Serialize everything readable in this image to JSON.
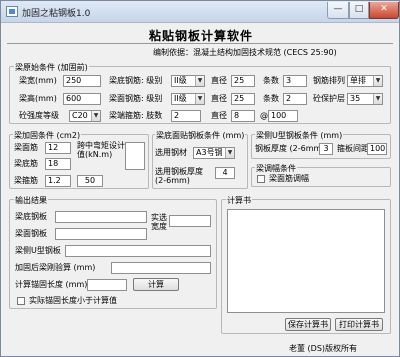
{
  "window": {
    "title": "加固之粘钢板1.0",
    "min": "—",
    "max": "□",
    "close": "✕"
  },
  "header": {
    "title": "粘贴钢板计算软件",
    "basis": "编制依据：混凝土结构加固技术规范 (CECS 25:90)"
  },
  "beam": {
    "legend": "梁原始条件 (加固前)",
    "width_label": "梁宽(mm)",
    "width_value": "250",
    "height_label": "梁高(mm)",
    "height_value": "600",
    "concrete_label": "砼强度等级",
    "concrete_value": "C20",
    "bottom_rebar_label": "梁底钢筋: 级别",
    "bottom_grade": "II级",
    "bottom_dia_label": "直径",
    "bottom_dia": "25",
    "bottom_count_label": "条数",
    "bottom_count": "3",
    "arrange_label": "钢筋排列",
    "arrange_value": "单排",
    "top_rebar_label": "梁面钢筋: 级别",
    "top_grade": "II级",
    "top_dia_label": "直径",
    "top_dia": "25",
    "top_count_label": "条数",
    "top_count": "2",
    "cover_label": "砼保护层",
    "cover_value": "35",
    "stirrup_label": "梁端箍筋: 肢数",
    "stirrup_legs": "2",
    "stirrup_dia_label": "直径",
    "stirrup_dia": "8",
    "at": "@",
    "stirrup_spacing": "100"
  },
  "reinforce": {
    "legend": "梁加固条件 (cm2)",
    "top_label": "梁面筋",
    "top_value": "12",
    "bottom_label": "梁底筋",
    "bottom_value": "18",
    "stirrup_label": "梁箍筋",
    "stirrup_value1": "1.2",
    "stirrup_value2": "50",
    "mid_label": "跨中弯矩设计值(kN.m)"
  },
  "bottom_plate": {
    "legend": "梁底面贴钢板条件 (mm)",
    "steel_label": "选用钢材",
    "steel_value": "A3号钢",
    "thickness_label": "选用钢板厚度 (2-6mm)",
    "thickness_value": "4"
  },
  "side_plate": {
    "legend": "梁侧U型钢板条件 (mm)",
    "thickness_label": "钢板厚度 (2-6mm)",
    "thickness_value": "3",
    "spacing_label": "箍板间距",
    "spacing_value": "100"
  },
  "beam_bend": {
    "legend": "梁调幅条件",
    "check_label": "梁面筋调幅"
  },
  "output": {
    "legend": "输出结果",
    "bottom_plate_label": "梁底钢板",
    "top_plate_label": "梁面钢板",
    "side_plate_label": "梁侧U型钢板",
    "width_label": "实选宽度",
    "anchor_label": "加固后梁刚验算 (mm)",
    "length_label": "计算锚固长度 (mm)",
    "calc_button": "计算",
    "check_label": "实际锚固长度小于计算值"
  },
  "calc_book": {
    "legend": "计算书",
    "save_button": "保存计算书",
    "print_button": "打印计算书"
  },
  "footer": {
    "copyright": "老董 (DS)版权所有"
  }
}
